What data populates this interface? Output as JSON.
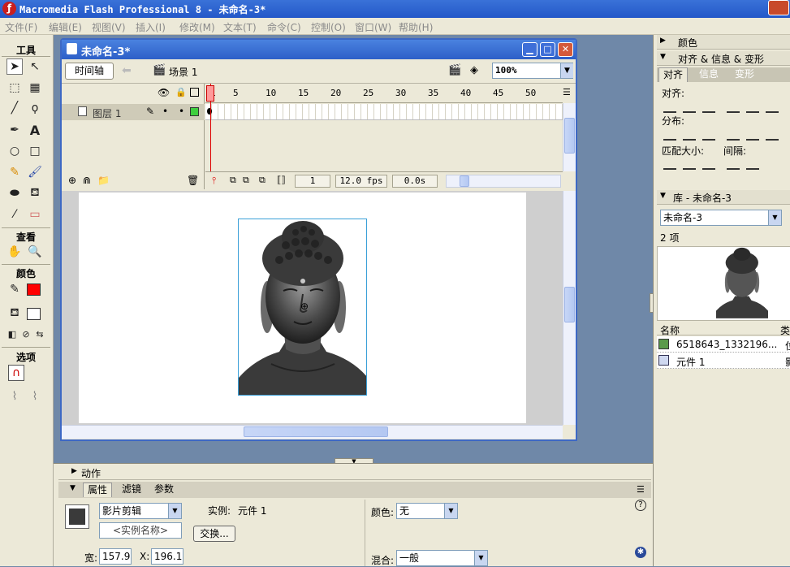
{
  "app": {
    "title": "Macromedia Flash Professional 8 - 未命名-3*"
  },
  "menu": {
    "items": [
      "文件(F)",
      "编辑(E)",
      "视图(V)",
      "插入(I)",
      "修改(M)",
      "文本(T)",
      "命令(C)",
      "控制(O)",
      "窗口(W)",
      "帮助(H)"
    ]
  },
  "tools": {
    "heading": "工具",
    "view_heading": "查看",
    "color_heading": "颜色",
    "options_heading": "选项",
    "stroke_color": "#ff0000",
    "fill_color": "#ffffff"
  },
  "document": {
    "title": "未命名-3*",
    "timeline_button": "时间轴",
    "scene": "场景 1",
    "zoom": "100%"
  },
  "timeline": {
    "layer_name": "图层 1",
    "frame_numbers": [
      "1",
      "5",
      "10",
      "15",
      "20",
      "25",
      "30",
      "35",
      "40",
      "45",
      "50"
    ],
    "current_frame": "1",
    "fps": "12.0 fps",
    "time": "0.0s"
  },
  "right_panels": {
    "color_panel": "颜色",
    "align_panel_title": "对齐 & 信息 & 变形",
    "tabs": [
      "对齐",
      "信息",
      "变形"
    ],
    "align_label": "对齐:",
    "distribute_label": "分布:",
    "match_size_label": "匹配大小:",
    "spacing_label": "间隔:",
    "library_title": "库 - 未命名-3",
    "library_select": "未命名-3",
    "library_count": "2 项",
    "col_name": "名称",
    "col_type": "类",
    "items": [
      {
        "name": "6518643_1332196...",
        "type": "位"
      },
      {
        "name": "元件 1",
        "type": "影"
      }
    ]
  },
  "properties": {
    "actions_panel": "动作",
    "tabs": [
      "属性",
      "滤镜",
      "参数"
    ],
    "symbol_type": "影片剪辑",
    "instance_name_placeholder": "<实例名称>",
    "instance_label": "实例:",
    "instance_value": "元件 1",
    "swap_button": "交换...",
    "color_label": "颜色:",
    "color_value": "无",
    "width_label": "宽:",
    "width_value": "157.9",
    "x_label": "X:",
    "x_value": "196.1",
    "blend_label": "混合:",
    "blend_value": "一般"
  }
}
